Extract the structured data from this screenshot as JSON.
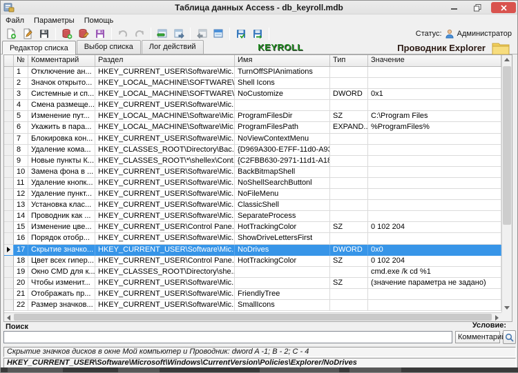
{
  "window": {
    "title": "Таблица данных Access - db_keyroll.mdb"
  },
  "menu": {
    "items": [
      {
        "label": "Файл"
      },
      {
        "label": "Параметры"
      },
      {
        "label": "Помощь"
      }
    ]
  },
  "toolbar": {
    "icons": [
      "new-file",
      "edit-file",
      "save-file",
      "db-add",
      "db-edit",
      "db-save",
      "undo",
      "redo",
      "window-remove-row",
      "window-export",
      "window-import",
      "window-table",
      "save-import",
      "save-export"
    ],
    "status_label": "Статус:",
    "status_value": "Администратор"
  },
  "tabs": [
    {
      "label": "Редактор списка",
      "active": true
    },
    {
      "label": "Выбор списка",
      "active": false
    },
    {
      "label": "Лог действий",
      "active": false
    }
  ],
  "brand": {
    "logo": "KEYROLL",
    "logo_color": "#1f8c1f",
    "panel_title": "Проводник Explorer"
  },
  "table": {
    "selection_color": "#3795e8",
    "selected_row": 17,
    "headers": {
      "num": "№",
      "comment": "Комментарий",
      "section": "Раздел",
      "name": "Имя",
      "type": "Тип",
      "value": "Значение"
    },
    "rows": [
      {
        "num": "1",
        "comment": "Отключение ан...",
        "section": "HKEY_CURRENT_USER\\Software\\Mic...",
        "name": "TurnOffSPIAnimations",
        "type": "",
        "value": ""
      },
      {
        "num": "2",
        "comment": "Значок открыто...",
        "section": "HKEY_LOCAL_MACHINE\\SOFTWARE\\...",
        "name": "Shell Icons",
        "type": "",
        "value": ""
      },
      {
        "num": "3",
        "comment": "Системные и сп...",
        "section": "HKEY_LOCAL_MACHINE\\SOFTWARE\\...",
        "name": "NoCustomize",
        "type": "DWORD",
        "value": "0x1"
      },
      {
        "num": "4",
        "comment": "Смена размеще...",
        "section": "HKEY_CURRENT_USER\\Software\\Mic...",
        "name": "",
        "type": "",
        "value": ""
      },
      {
        "num": "5",
        "comment": "Изменение пут...",
        "section": "HKEY_LOCAL_MACHINE\\Software\\Mic...",
        "name": "ProgramFilesDir",
        "type": "SZ",
        "value": "C:\\Program Files"
      },
      {
        "num": "6",
        "comment": "Укажить в пара...",
        "section": "HKEY_LOCAL_MACHINE\\Software\\Mic...",
        "name": "ProgramFilesPath",
        "type": "EXPAND...",
        "value": "%ProgramFiles%"
      },
      {
        "num": "7",
        "comment": "Блокировка кон...",
        "section": "HKEY_CURRENT_USER\\Software\\Mic...",
        "name": "NoViewContextMenu",
        "type": "",
        "value": ""
      },
      {
        "num": "8",
        "comment": "Удаление кома...",
        "section": "HKEY_CLASSES_ROOT\\Directory\\Bac...",
        "name": "{D969A300-E7FF-11d0-A93...",
        "type": "",
        "value": ""
      },
      {
        "num": "9",
        "comment": "Новые пункты К...",
        "section": "HKEY_CLASSES_ROOT\\*\\shellex\\Cont...",
        "name": "{C2FBB630-2971-11d1-A18...",
        "type": "",
        "value": ""
      },
      {
        "num": "10",
        "comment": "Замена фона в ...",
        "section": "HKEY_CURRENT_USER\\Software\\Mic...",
        "name": "BackBitmapShell",
        "type": "",
        "value": ""
      },
      {
        "num": "11",
        "comment": "Удаление кнопк...",
        "section": "HKEY_CURRENT_USER\\Software\\Mic...",
        "name": "NoShellSearchButtonl",
        "type": "",
        "value": ""
      },
      {
        "num": "12",
        "comment": "Удаление пункт...",
        "section": "HKEY_CURRENT_USER\\Software\\Mic...",
        "name": "NoFileMenu",
        "type": "",
        "value": ""
      },
      {
        "num": "13",
        "comment": "Установка клас...",
        "section": "HKEY_CURRENT_USER\\Software\\Mic...",
        "name": "ClassicShell",
        "type": "",
        "value": ""
      },
      {
        "num": "14",
        "comment": "Проводник как ...",
        "section": "HKEY_CURRENT_USER\\Software\\Mic...",
        "name": "SeparateProcess",
        "type": "",
        "value": ""
      },
      {
        "num": "15",
        "comment": "Изменение цве...",
        "section": "HKEY_CURRENT_USER\\Control Pane...",
        "name": "HotTrackingColor",
        "type": "SZ",
        "value": "0 102 204"
      },
      {
        "num": "16",
        "comment": "Порядок отобр...",
        "section": "HKEY_CURRENT_USER\\Software\\Mic...",
        "name": "ShowDriveLettersFirst",
        "type": "",
        "value": ""
      },
      {
        "num": "17",
        "comment": "Скрытие значко...",
        "section": "HKEY_CURRENT_USER\\Software\\Mic...",
        "name": "NoDrives",
        "type": "DWORD",
        "value": "0x0"
      },
      {
        "num": "18",
        "comment": "Цвет всех гипер...",
        "section": "HKEY_CURRENT_USER\\Control Pane...",
        "name": "HotTrackingColor",
        "type": "SZ",
        "value": "0 102 204"
      },
      {
        "num": "19",
        "comment": "Окно CMD для к...",
        "section": "HKEY_CLASSES_ROOT\\Directory\\she...",
        "name": "",
        "type": "",
        "value": "cmd.exe /k cd %1"
      },
      {
        "num": "20",
        "comment": "Чтобы изменит...",
        "section": "HKEY_CURRENT_USER\\Software\\Mic...",
        "name": "",
        "type": "SZ",
        "value": "(значение параметра не задано)"
      },
      {
        "num": "21",
        "comment": "Отображать пр...",
        "section": "HKEY_CURRENT_USER\\Software\\Mic...",
        "name": "FriendlyTree",
        "type": "",
        "value": ""
      },
      {
        "num": "22",
        "comment": "Размер значков...",
        "section": "HKEY_CURRENT_USER\\Software\\Mic...",
        "name": "SmallIcons",
        "type": "",
        "value": ""
      }
    ]
  },
  "search": {
    "label": "Поиск",
    "value": "",
    "condition_label": "Условие:",
    "condition_value": "Комментарий"
  },
  "status_bars": {
    "description": "Скрытие значков дисков в окне Мой компьютер и Проводник: dword A -1; B - 2; C - 4",
    "registry_path": "HKEY_CURRENT_USER\\Software\\Microsoft\\Windows\\CurrentVersion\\Policies\\Explorer/NoDrives"
  }
}
